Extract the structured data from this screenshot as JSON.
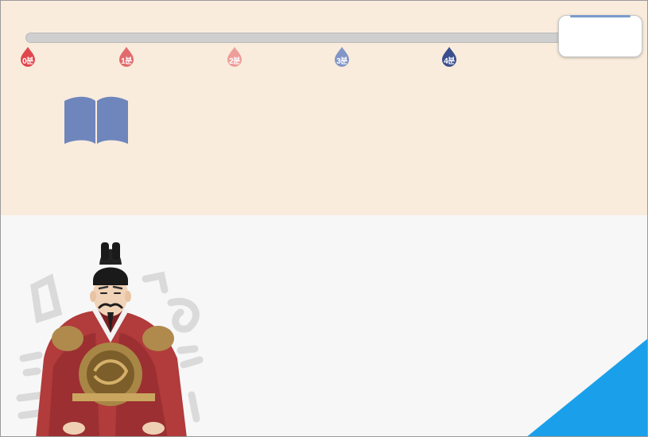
{
  "timeline": {
    "markers": [
      {
        "label": "0분",
        "color": "#e0474c"
      },
      {
        "label": "1분",
        "color": "#e26a6c"
      },
      {
        "label": "2분",
        "color": "#ee9e9a"
      },
      {
        "label": "3분",
        "color": "#8195c6"
      },
      {
        "label": "4분",
        "color": "#3a4f8d"
      }
    ]
  },
  "timer": {
    "value": ""
  },
  "book": {
    "icon": "book-icon",
    "color": "#6f86bd"
  },
  "illustration": {
    "subject": "king-portrait",
    "accent": "#b23b3b"
  },
  "corner": {
    "color": "#1aa0ea"
  }
}
